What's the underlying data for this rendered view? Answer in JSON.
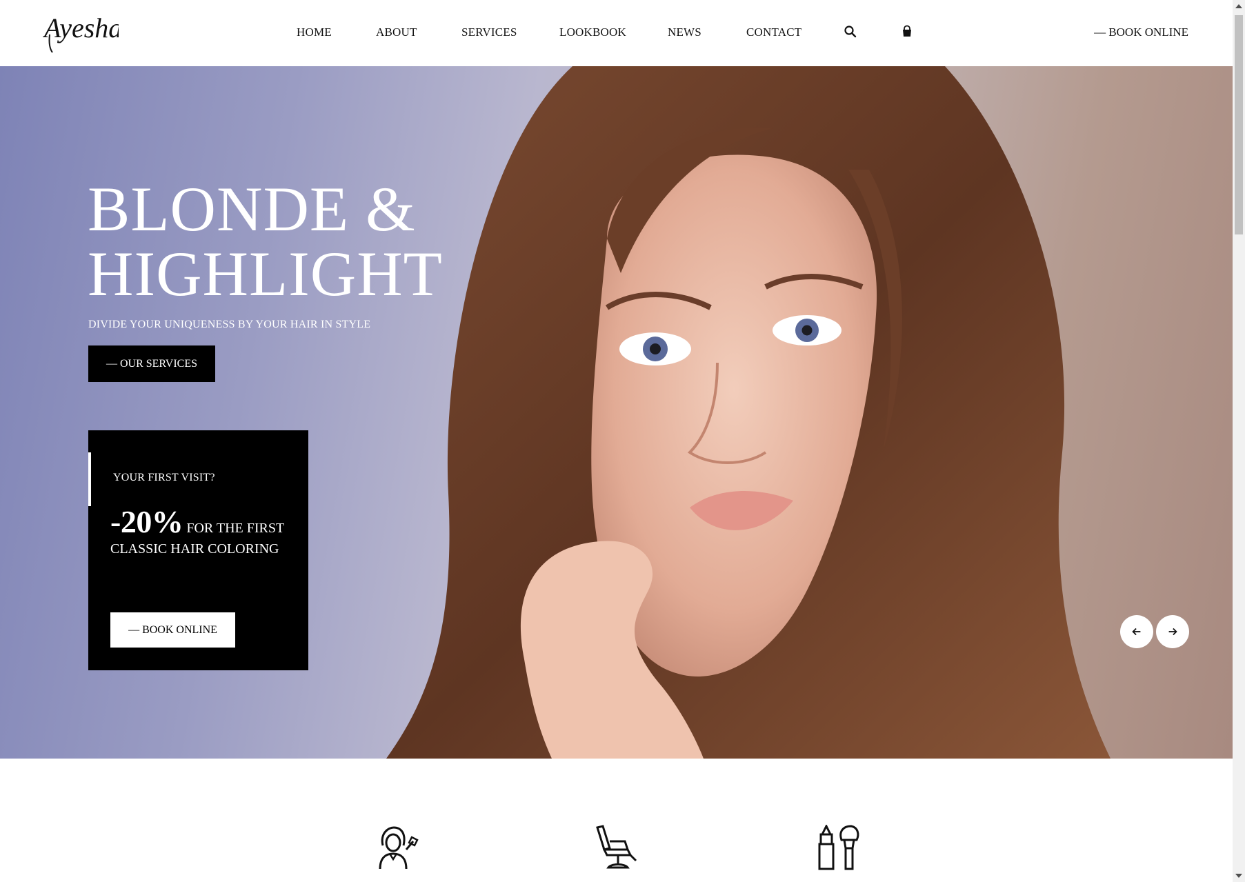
{
  "brand": {
    "logo_text": "Ayesha."
  },
  "nav": {
    "items": [
      {
        "label": "HOME"
      },
      {
        "label": "ABOUT"
      },
      {
        "label": "SERVICES"
      },
      {
        "label": "LOOKBOOK"
      },
      {
        "label": "NEWS"
      },
      {
        "label": "CONTACT"
      }
    ],
    "search_icon": "search-icon",
    "cart_icon": "shopping-bag-icon",
    "book_label": "— BOOK ONLINE"
  },
  "hero": {
    "title_line1": "BLONDE &",
    "title_line2": "HIGHLIGHT",
    "subtitle": "DIVIDE YOUR UNIQUENESS BY YOUR HAIR IN STYLE",
    "cta_label": "— OUR SERVICES",
    "prev_icon": "arrow-left-icon",
    "next_icon": "arrow-right-icon"
  },
  "promo": {
    "label": "YOUR FIRST VISIT?",
    "discount": "-20%",
    "offer_text": "FOR THE FIRST CLASSIC HAIR COLORING",
    "button_label": "— BOOK ONLINE"
  },
  "services_icons": [
    "stylist-icon",
    "barber-chair-icon",
    "makeup-icon"
  ],
  "colors": {
    "accent": "#000000",
    "text_light": "#ffffff"
  }
}
